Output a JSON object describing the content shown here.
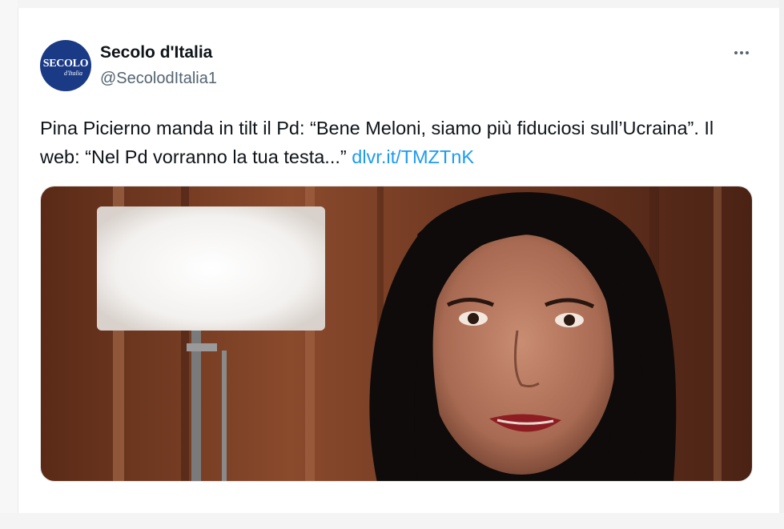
{
  "tweet": {
    "author": {
      "display_name": "Secolo d'Italia",
      "handle": "@SecolodItalia1",
      "avatar_text": "SECOLO",
      "avatar_subtext": "d'Italia"
    },
    "more_icon": "ellipsis-icon",
    "text_main": "Pina Picierno manda in tilt il Pd: “Bene Meloni, siamo più fiduciosi sull’Ucraina”. Il web: “Nel Pd vorranno la tua testa...”",
    "link": "dlvr.it/TMZTnK"
  },
  "colors": {
    "text_primary": "#0f1419",
    "text_secondary": "#536471",
    "link": "#1d9bf0",
    "avatar_bg": "#1a3a86"
  }
}
